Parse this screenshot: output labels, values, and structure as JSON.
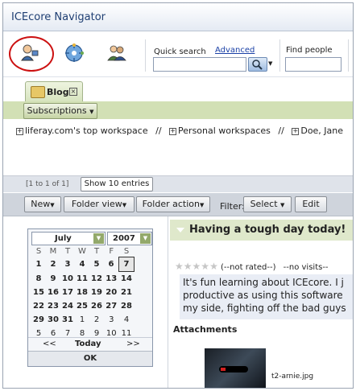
{
  "window": {
    "title": "ICEcore Navigator"
  },
  "toolbar": {
    "icons": [
      "user-avatar-icon",
      "globe-nav-icon",
      "people-icon"
    ],
    "quick_search_label": "Quick search",
    "advanced_link": "Advanced",
    "find_people_label": "Find people",
    "search_query": "",
    "people_query": ""
  },
  "tabs": [
    {
      "label": "Blog",
      "active": true
    }
  ],
  "subscriptions_label": "Subscriptions",
  "breadcrumbs": [
    "liferay.com's top workspace",
    "Personal workspaces",
    "Doe, Jane"
  ],
  "breadcrumb_separator": "//",
  "pager": {
    "count_text": "[1 to 1 of 1]",
    "entries_select": "Show 10 entries"
  },
  "actions": {
    "new_label": "New",
    "folder_view_label": "Folder view",
    "folder_action_label": "Folder action",
    "filter_label": "Filter:",
    "select_label": "Select",
    "edit_label": "Edit"
  },
  "calendar": {
    "month": "July",
    "year": "2007",
    "weekdays": [
      "S",
      "M",
      "T",
      "W",
      "T",
      "F",
      "S"
    ],
    "weeks": [
      [
        "1",
        "2",
        "3",
        "4",
        "5",
        "6",
        "7"
      ],
      [
        "8",
        "9",
        "10",
        "11",
        "12",
        "13",
        "14"
      ],
      [
        "15",
        "16",
        "17",
        "18",
        "19",
        "20",
        "21"
      ],
      [
        "22",
        "23",
        "24",
        "25",
        "26",
        "27",
        "28"
      ],
      [
        "29",
        "30",
        "31",
        "1",
        "2",
        "3",
        "4"
      ],
      [
        "5",
        "6",
        "7",
        "8",
        "9",
        "10",
        "11"
      ]
    ],
    "prev_label": "<<",
    "today_label": "Today",
    "next_label": ">>",
    "ok_label": "OK"
  },
  "entry": {
    "title": "Having a tough day today!",
    "rating_text": "(--not rated--)",
    "visits_text": "--no visits--",
    "star_count": 5,
    "body_lines": [
      "It's fun learning about ICEcore. I j",
      "productive as using this software",
      "my side, fighting off the bad guys"
    ],
    "attachments_heading": "Attachments",
    "attachment_file": "t2-arnie.jpg"
  },
  "colors": {
    "accent_green": "#d2e0b5",
    "title_blue": "#1f3f73",
    "highlight_red": "#cc1111"
  }
}
